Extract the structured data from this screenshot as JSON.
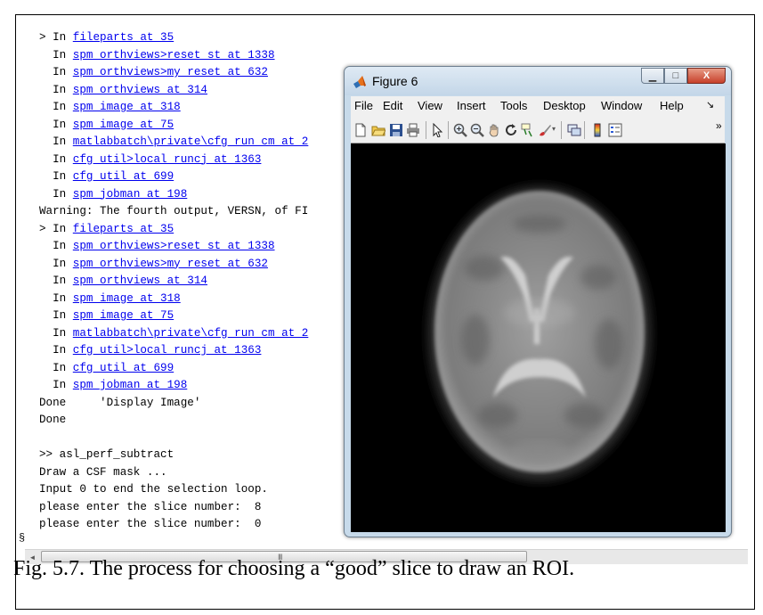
{
  "console": {
    "lines": [
      {
        "prefix": "> In ",
        "link": "fileparts at 35",
        "suffix": ""
      },
      {
        "prefix": "  In ",
        "link": "spm_orthviews>reset_st at 1338",
        "suffix": ""
      },
      {
        "prefix": "  In ",
        "link": "spm_orthviews>my_reset at 632",
        "suffix": ""
      },
      {
        "prefix": "  In ",
        "link": "spm_orthviews at 314",
        "suffix": ""
      },
      {
        "prefix": "  In ",
        "link": "spm_image at 318",
        "suffix": ""
      },
      {
        "prefix": "  In ",
        "link": "spm_image at 75",
        "suffix": ""
      },
      {
        "prefix": "  In ",
        "link": "matlabbatch\\private\\cfg_run_cm at 2",
        "suffix": ""
      },
      {
        "prefix": "  In ",
        "link": "cfg_util>local_runcj at 1363",
        "suffix": ""
      },
      {
        "prefix": "  In ",
        "link": "cfg_util at 699",
        "suffix": ""
      },
      {
        "prefix": "  In ",
        "link": "spm_jobman at 198",
        "suffix": ""
      },
      {
        "prefix": "Warning: The fourth output, VERSN, of FI",
        "link": "",
        "suffix": ""
      },
      {
        "prefix": "> In ",
        "link": "fileparts at 35",
        "suffix": ""
      },
      {
        "prefix": "  In ",
        "link": "spm_orthviews>reset_st at 1338",
        "suffix": ""
      },
      {
        "prefix": "  In ",
        "link": "spm_orthviews>my_reset at 632",
        "suffix": ""
      },
      {
        "prefix": "  In ",
        "link": "spm_orthviews at 314",
        "suffix": ""
      },
      {
        "prefix": "  In ",
        "link": "spm_image at 318",
        "suffix": ""
      },
      {
        "prefix": "  In ",
        "link": "spm_image at 75",
        "suffix": ""
      },
      {
        "prefix": "  In ",
        "link": "matlabbatch\\private\\cfg_run_cm at 2",
        "suffix": ""
      },
      {
        "prefix": "  In ",
        "link": "cfg_util>local_runcj at 1363",
        "suffix": ""
      },
      {
        "prefix": "  In ",
        "link": "cfg_util at 699",
        "suffix": ""
      },
      {
        "prefix": "  In ",
        "link": "spm_jobman at 198",
        "suffix": ""
      },
      {
        "prefix": "Done     'Display Image'",
        "link": "",
        "suffix": ""
      },
      {
        "prefix": "Done",
        "link": "",
        "suffix": ""
      },
      {
        "prefix": "",
        "link": "",
        "suffix": ""
      },
      {
        "prefix": ">> asl_perf_subtract",
        "link": "",
        "suffix": ""
      },
      {
        "prefix": "Draw a CSF mask ...",
        "link": "",
        "suffix": ""
      },
      {
        "prefix": "Input 0 to end the selection loop.",
        "link": "",
        "suffix": ""
      },
      {
        "prefix": "please enter the slice number:  8",
        "link": "",
        "suffix": ""
      },
      {
        "prefix": "please enter the slice number:  0",
        "link": "",
        "suffix": ""
      }
    ],
    "prompt_stub": "§"
  },
  "scrollbar": {
    "left_arrow": "◄",
    "grip": "III"
  },
  "figure_window": {
    "title": "Figure 6",
    "buttons": {
      "minimize": "▁",
      "maximize": "□",
      "close": "X"
    },
    "menu": [
      "File",
      "Edit",
      "View",
      "Insert",
      "Tools",
      "Desktop",
      "Window",
      "Help",
      "↘"
    ],
    "toolbar_icons": [
      "new-figure-icon",
      "open-file-icon",
      "save-icon",
      "print-icon",
      "pointer-icon",
      "zoom-in-icon",
      "zoom-out-icon",
      "pan-icon",
      "rotate-icon",
      "data-cursor-icon",
      "brush-icon",
      "link-plot-icon",
      "colorbar-icon",
      "legend-icon"
    ],
    "toolbar_overflow": "»",
    "image_content": "axial brain MRI slice"
  },
  "caption": "Fig. 5.7. The process for choosing a “good” slice to draw an ROI.",
  "colors": {
    "link": "#0000ee",
    "titlebar": "#c7daea",
    "close_button": "#c7402a",
    "axes_bg": "#000000"
  }
}
